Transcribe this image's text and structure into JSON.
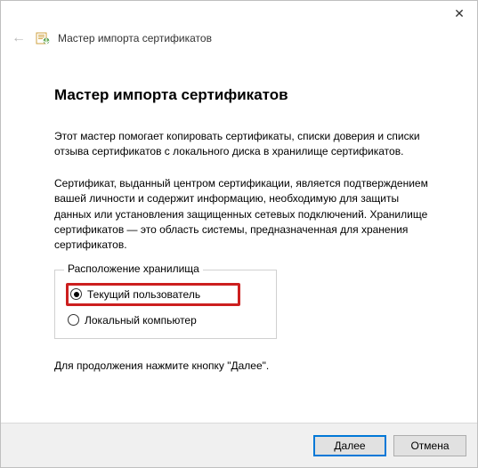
{
  "window": {
    "close_label": "✕"
  },
  "header": {
    "back_icon": "←",
    "title": "Мастер импорта сертификатов"
  },
  "main": {
    "heading": "Мастер импорта сертификатов",
    "intro": "Этот мастер помогает копировать сертификаты, списки доверия и списки отзыва сертификатов с локального диска в хранилище сертификатов.",
    "body": "Сертификат, выданный центром сертификации, является подтверждением вашей личности и содержит информацию, необходимую для защиты данных или установления защищенных сетевых подключений. Хранилище сертификатов — это область системы, предназначенная для хранения сертификатов.",
    "group": {
      "legend": "Расположение хранилища",
      "options": [
        {
          "label": "Текущий пользователь",
          "selected": true
        },
        {
          "label": "Локальный компьютер",
          "selected": false
        }
      ]
    },
    "continue_hint": "Для продолжения нажмите кнопку \"Далее\"."
  },
  "footer": {
    "next": "Далее",
    "cancel": "Отмена"
  }
}
